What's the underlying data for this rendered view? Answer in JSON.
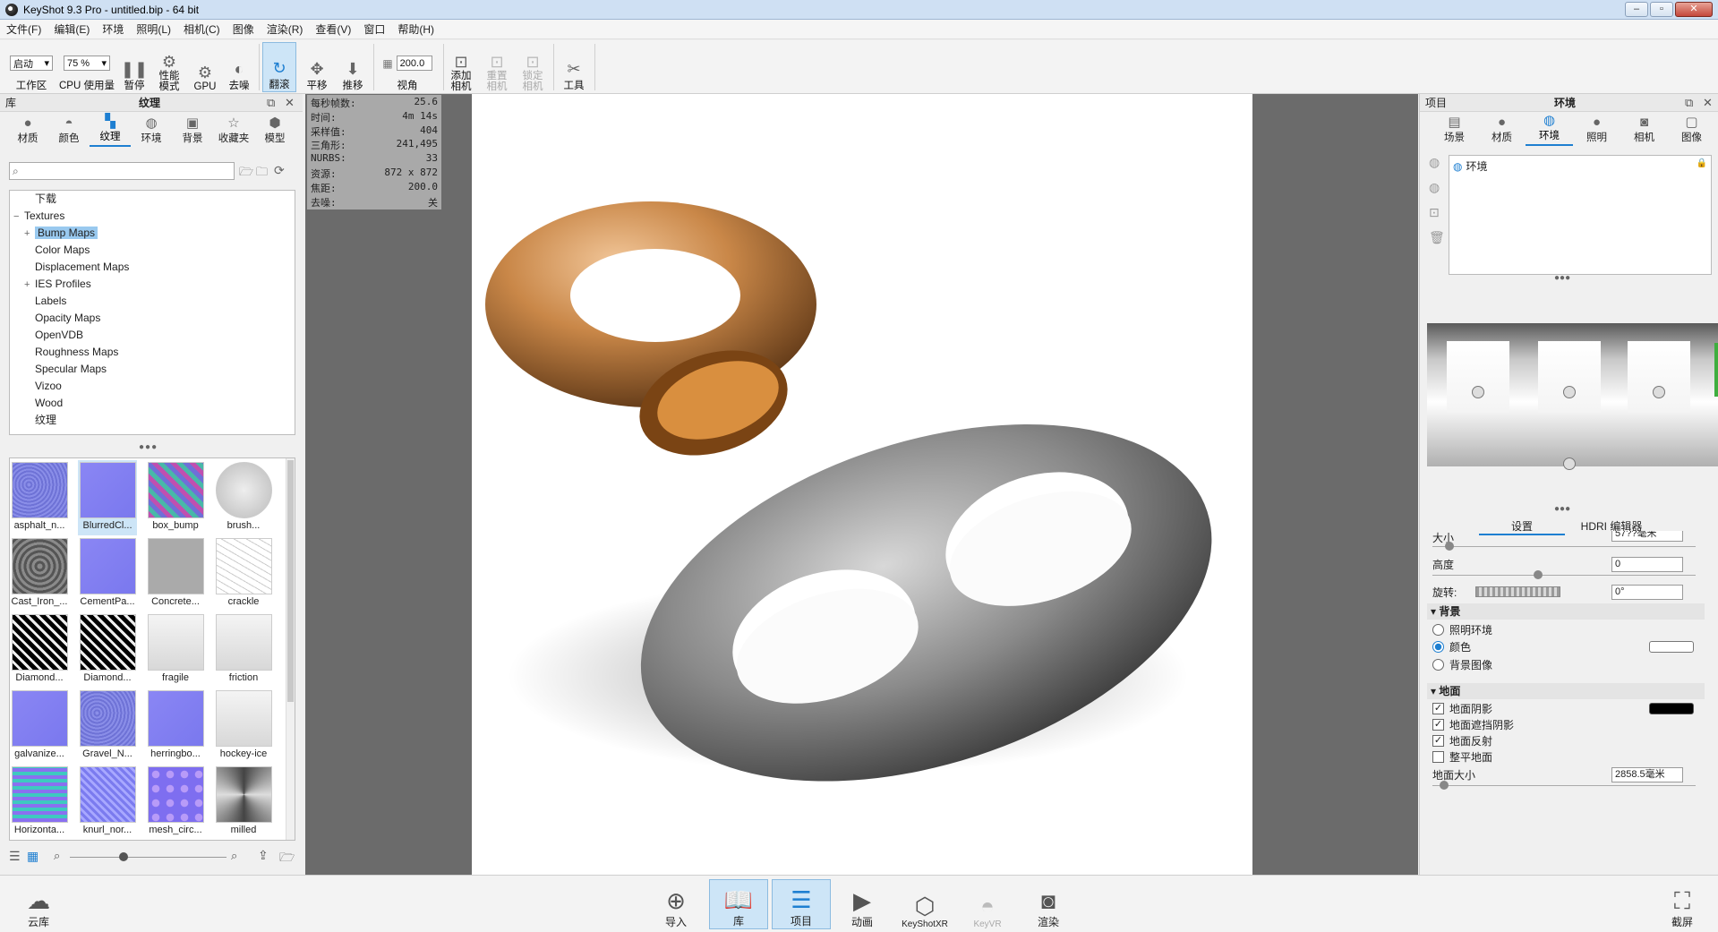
{
  "window": {
    "title": "KeyShot 9.3 Pro  - untitled.bip  - 64 bit"
  },
  "menu": [
    "文件(F)",
    "编辑(E)",
    "环境",
    "照明(L)",
    "相机(C)",
    "图像",
    "渲染(R)",
    "查看(V)",
    "窗口",
    "帮助(H)"
  ],
  "toolbar": {
    "workspace_select": "启动",
    "workspace_label": "工作区",
    "cpu_select": "75 %",
    "cpu_label": "CPU 使用量",
    "pause_label": "暂停",
    "perf_label": "性能\n模式",
    "gpu_label": "GPU",
    "denoise_label": "去噪",
    "tumble_label": "翻滚",
    "pan_label": "平移",
    "dolly_label": "推移",
    "fov_value": "200.0",
    "fov_label": "视角",
    "add_camera_label": "添加\n相机",
    "reset_camera_label": "重置\n相机",
    "lock_camera_label": "锁定\n相机",
    "tools_label": "工具"
  },
  "library": {
    "header": "库",
    "title": "纹理",
    "tabs": [
      "材质",
      "颜色",
      "纹理",
      "环境",
      "背景",
      "收藏夹",
      "模型"
    ],
    "active_tab": "纹理",
    "search_placeholder": "",
    "tree": [
      {
        "label": "下载",
        "level": 1,
        "expander": ""
      },
      {
        "label": "Textures",
        "level": 0,
        "expander": "−"
      },
      {
        "label": "Bump Maps",
        "level": 2,
        "expander": "+",
        "selected": true
      },
      {
        "label": "Color Maps",
        "level": 2,
        "expander": ""
      },
      {
        "label": "Displacement Maps",
        "level": 2,
        "expander": ""
      },
      {
        "label": "IES Profiles",
        "level": 2,
        "expander": "+"
      },
      {
        "label": "Labels",
        "level": 2,
        "expander": ""
      },
      {
        "label": "Opacity Maps",
        "level": 2,
        "expander": ""
      },
      {
        "label": "OpenVDB",
        "level": 2,
        "expander": ""
      },
      {
        "label": "Roughness Maps",
        "level": 2,
        "expander": ""
      },
      {
        "label": "Specular Maps",
        "level": 2,
        "expander": ""
      },
      {
        "label": "Vizoo",
        "level": 2,
        "expander": ""
      },
      {
        "label": "Wood",
        "level": 2,
        "expander": ""
      },
      {
        "label": "纹理",
        "level": 2,
        "expander": ""
      }
    ],
    "thumbnails": [
      {
        "label": "asphalt_n...",
        "style": "noise-blue"
      },
      {
        "label": "BlurredCl...",
        "style": "flat-blue",
        "selected": true
      },
      {
        "label": "box_bump",
        "style": "pixel"
      },
      {
        "label": "brush...",
        "style": "brushed"
      },
      {
        "label": "Cast_Iron_...",
        "style": "gray-rough"
      },
      {
        "label": "CementPa...",
        "style": "flat-blue"
      },
      {
        "label": "Concrete...",
        "style": "gray-light"
      },
      {
        "label": "crackle",
        "style": "crackle"
      },
      {
        "label": "Diamond...",
        "style": "diamond-dark"
      },
      {
        "label": "Diamond...",
        "style": "diamond-dark"
      },
      {
        "label": "fragile",
        "style": "gray-pale"
      },
      {
        "label": "friction",
        "style": "gray-pale"
      },
      {
        "label": "galvanize...",
        "style": "flat-blue"
      },
      {
        "label": "Gravel_N...",
        "style": "noise-blue"
      },
      {
        "label": "herringbo...",
        "style": "flat-blue"
      },
      {
        "label": "hockey-ice",
        "style": "gray-pale"
      },
      {
        "label": "Horizonta...",
        "style": "stripes"
      },
      {
        "label": "knurl_nor...",
        "style": "knurl"
      },
      {
        "label": "mesh_circ...",
        "style": "circles"
      },
      {
        "label": "milled",
        "style": "milled"
      }
    ]
  },
  "stats": [
    {
      "k": "每秒帧数:",
      "v": "25.6"
    },
    {
      "k": "时间:",
      "v": "4m 14s"
    },
    {
      "k": "采样值:",
      "v": "404"
    },
    {
      "k": "三角形:",
      "v": "241,495"
    },
    {
      "k": "NURBS:",
      "v": "33"
    },
    {
      "k": "资源:",
      "v": "872 x 872"
    },
    {
      "k": "焦距:",
      "v": "200.0"
    },
    {
      "k": "去噪:",
      "v": "关"
    }
  ],
  "project": {
    "header": "项目",
    "title": "环境",
    "tabs": [
      "场景",
      "材质",
      "环境",
      "照明",
      "相机",
      "图像"
    ],
    "active_tab": "环境",
    "env_list": [
      "环境"
    ],
    "subtabs": [
      "设置",
      "HDRI 编辑器"
    ],
    "active_subtab": "设置",
    "size_label": "大小",
    "size_value": "57??毫米",
    "height_label": "高度",
    "height_value": "0",
    "rotation_label": "旋转:",
    "rotation_value": "0°",
    "background_section": "背景",
    "bg_options": [
      "照明环境",
      "颜色",
      "背景图像"
    ],
    "bg_selected": "颜色",
    "bg_color": "#ffffff",
    "ground_section": "地面",
    "ground_options": [
      {
        "label": "地面阴影",
        "checked": true
      },
      {
        "label": "地面遮挡阴影",
        "checked": true
      },
      {
        "label": "地面反射",
        "checked": true
      },
      {
        "label": "整平地面",
        "checked": false
      }
    ],
    "shadow_color": "#000000",
    "ground_size_label": "地面大小",
    "ground_size_value": "2858.5毫米"
  },
  "bottombar": {
    "cloud_label": "云库",
    "buttons": [
      {
        "label": "导入",
        "icon": "import-icon"
      },
      {
        "label": "库",
        "icon": "library-icon",
        "active": true
      },
      {
        "label": "项目",
        "icon": "project-icon",
        "active": true
      },
      {
        "label": "动画",
        "icon": "animation-icon"
      },
      {
        "label": "KeyShotXR",
        "icon": "keyshotxr-icon"
      },
      {
        "label": "KeyVR",
        "icon": "keyvr-icon",
        "disabled": true
      },
      {
        "label": "渲染",
        "icon": "render-icon"
      }
    ],
    "screenshot_label": "截屏"
  },
  "colors": {
    "accent": "#1e7fd1",
    "selected_bg": "#cde5f7",
    "viewport_bg": "#6b6b6b"
  }
}
